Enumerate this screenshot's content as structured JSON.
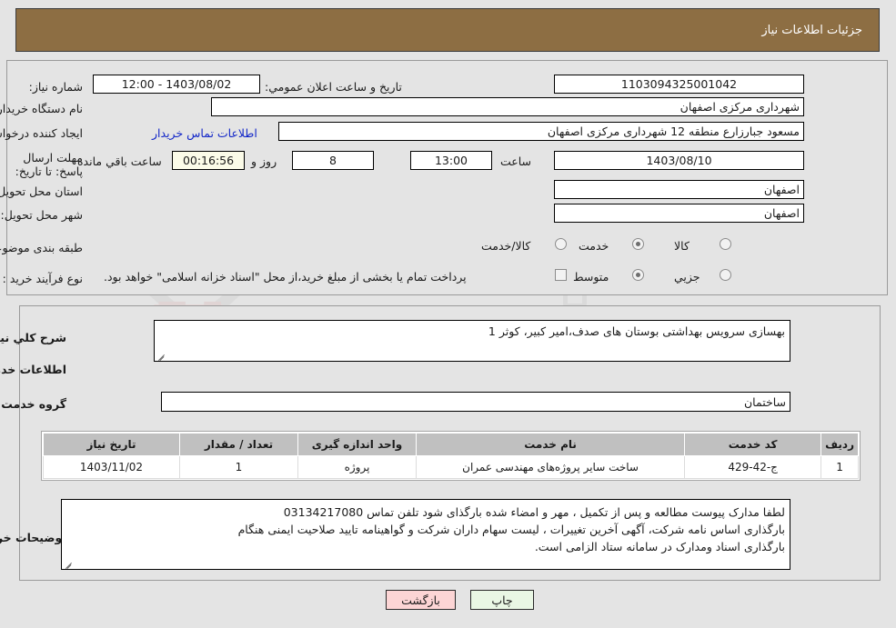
{
  "header": {
    "title": "جزئیات اطلاعات نیاز"
  },
  "watermark": {
    "text": "AriaTender.net"
  },
  "top_form": {
    "need_number_label": "شماره نیاز:",
    "need_number_value": "1103094325001042",
    "announce_label": "تاریخ و ساعت اعلان عمومي:",
    "announce_value": "1403/08/02 - 12:00",
    "buyer_org_label": "نام دستگاه خریدار:",
    "buyer_org_value": "شهرداری مرکزی اصفهان",
    "requester_label": "ایجاد کننده درخواست:",
    "requester_value": "مسعود جبارزارع منطقه 12 شهرداری مرکزی اصفهان",
    "contact_link": "اطلاعات تماس خریدار",
    "deadline_label": "مهلت ارسال پاسخ: تا تاریخ:",
    "deadline_date": "1403/08/10",
    "hour_label": "ساعت",
    "hour_value": "13:00",
    "days_value": "8",
    "days_unit": "روز و",
    "countdown_value": "00:16:56",
    "countdown_unit": "ساعت باقي مانده",
    "province_label": "استان محل تحویل:",
    "province_value": "اصفهان",
    "city_label": "شهر محل تحویل:",
    "city_value": "اصفهان",
    "category_label": "طبقه بندی موضوعی:",
    "category_options": [
      {
        "label": "کالا",
        "selected": false
      },
      {
        "label": "خدمت",
        "selected": true
      },
      {
        "label": "کالا/خدمت",
        "selected": false
      }
    ],
    "process_label": "نوع فرآیند خرید :",
    "process_options": [
      {
        "label": "جزیي",
        "selected": false
      },
      {
        "label": "متوسط",
        "selected": true
      }
    ],
    "treasury_checkbox_label": "پرداخت تمام یا بخشی از مبلغ خرید،از محل \"اسناد خزانه اسلامی\" خواهد بود.",
    "treasury_checked": false
  },
  "main": {
    "general_desc_label": "شرح كلي نياز:",
    "general_desc_value": "بهسازی سرویس بهداشتی بوستان های صدف،امیر کبیر، کوثر 1",
    "services_section_title": "اطلاعات خدمات مورد نیاز",
    "service_group_label": "گروه خدمت:",
    "service_group_value": "ساختمان",
    "table": {
      "columns": [
        "ردیف",
        "کد خدمت",
        "نام خدمت",
        "واحد اندازه گیری",
        "تعداد / مقدار",
        "تاریخ نیاز"
      ],
      "rows": [
        [
          "1",
          "ج-42-429",
          "ساخت سایر پروژه‌های مهندسی عمران",
          "پروژه",
          "1",
          "1403/11/02"
        ]
      ]
    },
    "buyer_notes_label": "توضیحات خریدار:",
    "buyer_notes_lines": [
      "لطفا مدارک پیوست مطالعه و پس از تکمیل ، مهر و امضاء شده بارگذای شود تلفن تماس 03134217080",
      "بارگذاری اساس نامه شرکت، آگهی آخرین تغییرات ، لیست سهام داران شرکت و گواهینامه تایید صلاحیت ایمنی هنگام",
      "بارگذاری اسناد ومدارک در سامانه ستاد الزامی است."
    ]
  },
  "footer": {
    "print_label": "چاپ",
    "back_label": "بازگشت"
  },
  "colors": {
    "header_brown": "#8d6e43",
    "page_bg": "#e4e4e4",
    "link_blue": "#1226c8",
    "table_header": "#c0c0c0",
    "timer_bg": "#fbfbe8",
    "print_btn": "#e9f7e4",
    "back_btn": "#fcd5d5"
  }
}
